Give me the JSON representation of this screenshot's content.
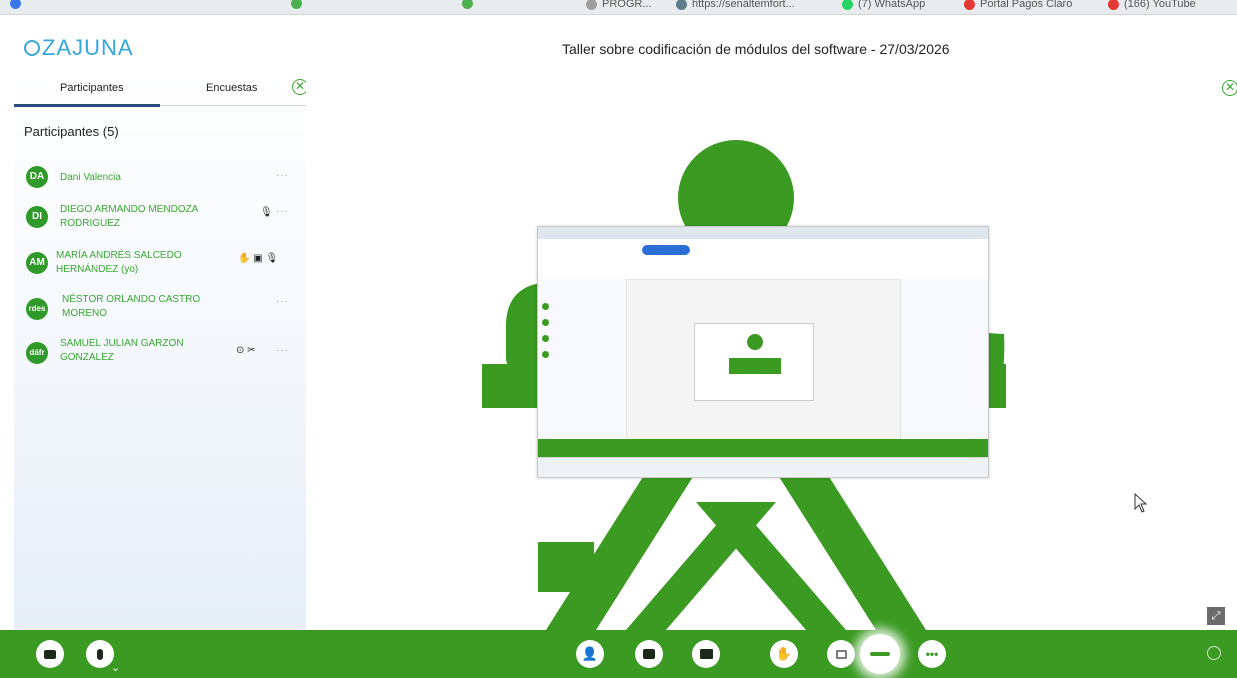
{
  "browser": {
    "bookmarks": [
      {
        "label": "PROGR...",
        "icon": "file-icon",
        "color": "#9e9e9e"
      },
      {
        "label": "https://senaltemfort...",
        "icon": "globe-icon",
        "color": "#607d8b"
      },
      {
        "label": "(7) WhatsApp",
        "icon": "whatsapp-icon",
        "color": "#25d366"
      },
      {
        "label": "Portal Pagos Claro",
        "icon": "claro-icon",
        "color": "#e53935"
      },
      {
        "label": "(166) YouTube",
        "icon": "youtube-icon",
        "color": "#e53935"
      }
    ]
  },
  "app": {
    "logo_text": "ZAJUNA",
    "meeting_title": "Taller sobre codificación de módulos del software - 27/03/2026",
    "brand_color": "#3a9a21",
    "accent_color": "#36a7d9"
  },
  "sidebar": {
    "tabs": [
      {
        "label": "Participantes",
        "active": true
      },
      {
        "label": "Encuestas",
        "active": false
      }
    ],
    "participants_title": "Participantes (5)",
    "participants": [
      {
        "initials": "DA",
        "name": "Dani Valencia",
        "status_icons": "",
        "menu": "···"
      },
      {
        "initials": "DI",
        "name": "DIEGO ARMANDO MENDOZA RODRIGUEZ",
        "status_icons": "🎙",
        "menu": "···"
      },
      {
        "initials": "AM",
        "name": "MARÍA ANDRÉS SALCEDO HERNÁNDEZ (yo)",
        "status_icons": "✋ ▣ 🎙",
        "menu": ""
      },
      {
        "initials": "rdes",
        "name": "NÉSTOR ORLANDO CASTRO MORENO",
        "status_icons": "",
        "menu": "···"
      },
      {
        "initials": "dáfr",
        "name": "SAMUEL JULIAN GARZON GONZALEZ",
        "status_icons": "⊙ ✂",
        "menu": "···"
      }
    ]
  },
  "toolbar": {
    "left": [
      {
        "icon": "camera-icon"
      },
      {
        "icon": "microphone-icon"
      }
    ],
    "center": [
      {
        "icon": "participants-icon"
      },
      {
        "icon": "chat-icon"
      },
      {
        "icon": "share-screen-icon"
      },
      {
        "icon": "raise-hand-icon"
      },
      {
        "icon": "whiteboard-icon"
      },
      {
        "icon": "record-icon"
      },
      {
        "icon": "more-icon",
        "label": "•••"
      }
    ],
    "right": [
      {
        "icon": "emoji-icon"
      }
    ]
  }
}
